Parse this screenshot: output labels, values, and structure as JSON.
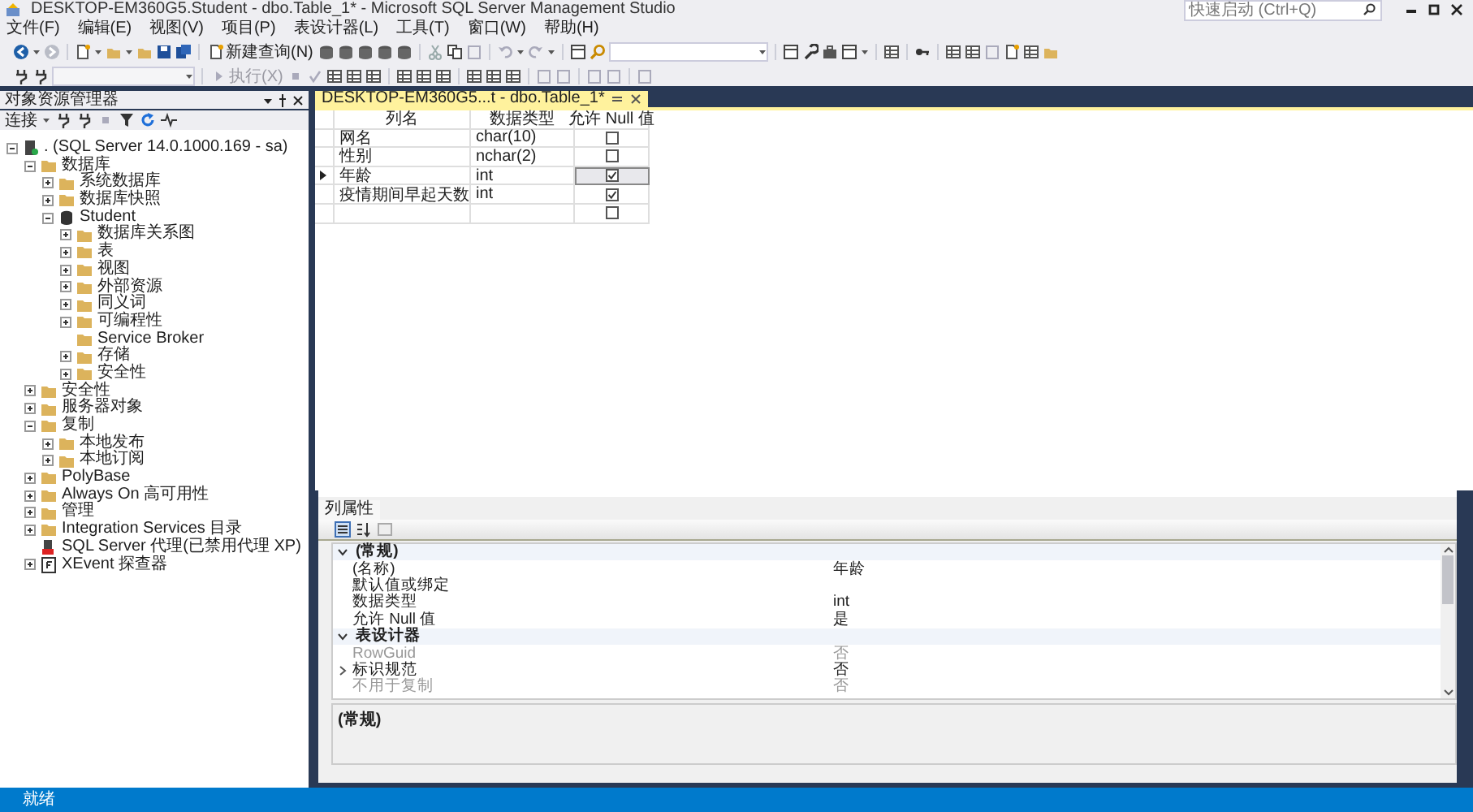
{
  "window": {
    "title": "DESKTOP-EM360G5.Student - dbo.Table_1* - Microsoft SQL Server Management Studio"
  },
  "quick_launch": {
    "placeholder": "快速启动 (Ctrl+Q)"
  },
  "menu": [
    "文件(F)",
    "编辑(E)",
    "视图(V)",
    "项目(P)",
    "表设计器(L)",
    "工具(T)",
    "窗口(W)",
    "帮助(H)"
  ],
  "toolbar": {
    "new_query": "新建查询(N)",
    "execute": "执行(X)"
  },
  "object_explorer": {
    "title": "对象资源管理器",
    "connect": "连接",
    "tree": [
      {
        "label": ". (SQL Server 14.0.1000.169 - sa)",
        "kind": "server",
        "expanded": true,
        "children": [
          {
            "label": "数据库",
            "kind": "folder",
            "expanded": true,
            "children": [
              {
                "label": "系统数据库",
                "kind": "folder",
                "expanded": false
              },
              {
                "label": "数据库快照",
                "kind": "folder",
                "expanded": false
              },
              {
                "label": "Student",
                "kind": "database",
                "expanded": true,
                "children": [
                  {
                    "label": "数据库关系图",
                    "kind": "folder",
                    "expanded": false
                  },
                  {
                    "label": "表",
                    "kind": "folder",
                    "expanded": false
                  },
                  {
                    "label": "视图",
                    "kind": "folder",
                    "expanded": false
                  },
                  {
                    "label": "外部资源",
                    "kind": "folder",
                    "expanded": false
                  },
                  {
                    "label": "同义词",
                    "kind": "folder",
                    "expanded": false
                  },
                  {
                    "label": "可编程性",
                    "kind": "folder",
                    "expanded": false
                  },
                  {
                    "label": "Service Broker",
                    "kind": "folder"
                  },
                  {
                    "label": "存储",
                    "kind": "folder",
                    "expanded": false
                  },
                  {
                    "label": "安全性",
                    "kind": "folder",
                    "expanded": false
                  }
                ]
              }
            ]
          },
          {
            "label": "安全性",
            "kind": "folder",
            "expanded": false
          },
          {
            "label": "服务器对象",
            "kind": "folder",
            "expanded": false
          },
          {
            "label": "复制",
            "kind": "folder",
            "expanded": true,
            "children": [
              {
                "label": "本地发布",
                "kind": "folder",
                "expanded": false
              },
              {
                "label": "本地订阅",
                "kind": "folder",
                "expanded": false
              }
            ]
          },
          {
            "label": "PolyBase",
            "kind": "folder",
            "expanded": false
          },
          {
            "label": "Always On 高可用性",
            "kind": "folder",
            "expanded": false
          },
          {
            "label": "管理",
            "kind": "folder",
            "expanded": false
          },
          {
            "label": "Integration Services 目录",
            "kind": "folder",
            "expanded": false
          },
          {
            "label": "SQL Server 代理(已禁用代理 XP)",
            "kind": "agent"
          },
          {
            "label": "XEvent 探查器",
            "kind": "xevent",
            "expanded": false
          }
        ]
      }
    ]
  },
  "document_tab": {
    "label": "DESKTOP-EM360G5...t - dbo.Table_1*"
  },
  "table_designer": {
    "columns": [
      "列名",
      "数据类型",
      "允许 Null 值"
    ],
    "rows": [
      {
        "name": "网名",
        "type": "char(10)",
        "allow_null": false,
        "selected": false
      },
      {
        "name": "性别",
        "type": "nchar(2)",
        "allow_null": false,
        "selected": false
      },
      {
        "name": "年龄",
        "type": "int",
        "allow_null": true,
        "selected": true
      },
      {
        "name": "疫情期间早起天数",
        "type": "int",
        "allow_null": true,
        "selected": false
      },
      {
        "allow_null": false,
        "selected": false
      }
    ]
  },
  "properties": {
    "tab": "列属性",
    "groups": [
      {
        "title": "(常规)",
        "expanded": true,
        "items": [
          {
            "name": "(名称)",
            "value": "年龄",
            "disabled": false,
            "expandable": false
          },
          {
            "name": "默认值或绑定",
            "disabled": false,
            "expandable": false
          },
          {
            "name": "数据类型",
            "value": "int",
            "disabled": false,
            "expandable": false
          },
          {
            "name": "允许 Null 值",
            "value": "是",
            "disabled": false,
            "expandable": false
          }
        ]
      },
      {
        "title": "表设计器",
        "expanded": true,
        "items": [
          {
            "name": "RowGuid",
            "value": "否",
            "disabled": true,
            "expandable": false
          },
          {
            "name": "标识规范",
            "value": "否",
            "disabled": false,
            "expandable": true
          },
          {
            "name": "不用于复制",
            "value": "否",
            "disabled": true,
            "expandable": false
          }
        ]
      }
    ],
    "description": "(常规)"
  },
  "status_bar": {
    "text": "就绪"
  }
}
